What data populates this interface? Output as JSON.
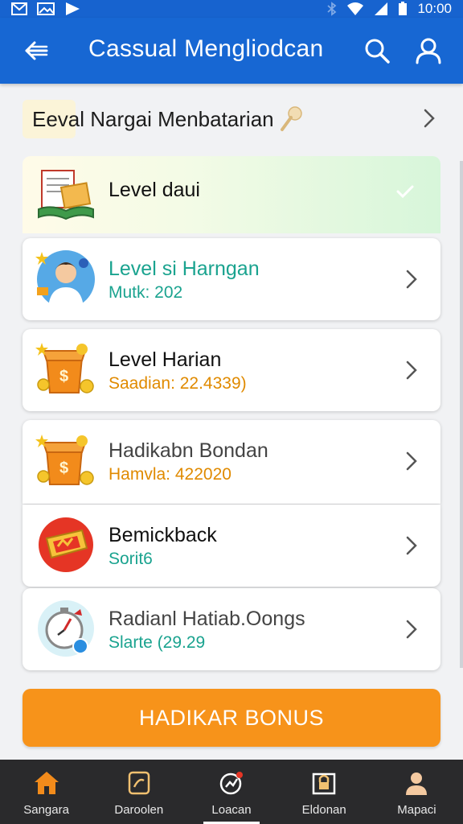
{
  "status_bar": {
    "time": "10:00",
    "icons": [
      "mail-icon",
      "image-icon",
      "play-icon",
      "bluetooth-icon",
      "wifi-icon",
      "signal-icon",
      "battery-icon"
    ]
  },
  "app_bar": {
    "title": "Cassual Mengliodcan",
    "icons": [
      "back-arrow-icon",
      "search-icon",
      "user-icon"
    ]
  },
  "section": {
    "label": "Eeval Nargai Menbatarian",
    "icon": "key-icon"
  },
  "list": [
    {
      "title": "Level daui",
      "subtitle": "",
      "icon": "book-scroll-icon",
      "state": "checked"
    },
    {
      "title": "Level si Harngan",
      "subtitle": "Mutk: 202",
      "icon": "person-avatar-icon",
      "subtitle_color": "#1aa38f"
    },
    {
      "title": "Level Harian",
      "subtitle": "Saadian: 22.4339)",
      "icon": "gift-box-icon",
      "subtitle_color": "#e08a00"
    },
    {
      "title": "Hadikabn Bondan",
      "subtitle": "Hamvla: 422020",
      "icon": "gift-box-icon",
      "subtitle_color": "#e08a00"
    },
    {
      "title": "Bemickback",
      "subtitle": "Sorit6",
      "icon": "ticket-badge-icon",
      "subtitle_color": "#1aa38f"
    },
    {
      "title": "Radianl Hatiab.Oongs",
      "subtitle": "Slarte (29.29",
      "icon": "stopwatch-icon",
      "subtitle_color": "#1aa38f"
    }
  ],
  "cta": {
    "label": "HADIKAR BONUS"
  },
  "bottom_nav": [
    {
      "label": "Sangara",
      "icon": "home-icon"
    },
    {
      "label": "Daroolen",
      "icon": "card-icon"
    },
    {
      "label": "Loacan",
      "icon": "chart-icon",
      "active": true
    },
    {
      "label": "Eldonan",
      "icon": "lock-icon"
    },
    {
      "label": "Mapaci",
      "icon": "profile-icon"
    }
  ],
  "colors": {
    "primary": "#1767d3",
    "accent": "#f7931a",
    "teal": "#1aa38f",
    "orange_text": "#e08a00"
  }
}
